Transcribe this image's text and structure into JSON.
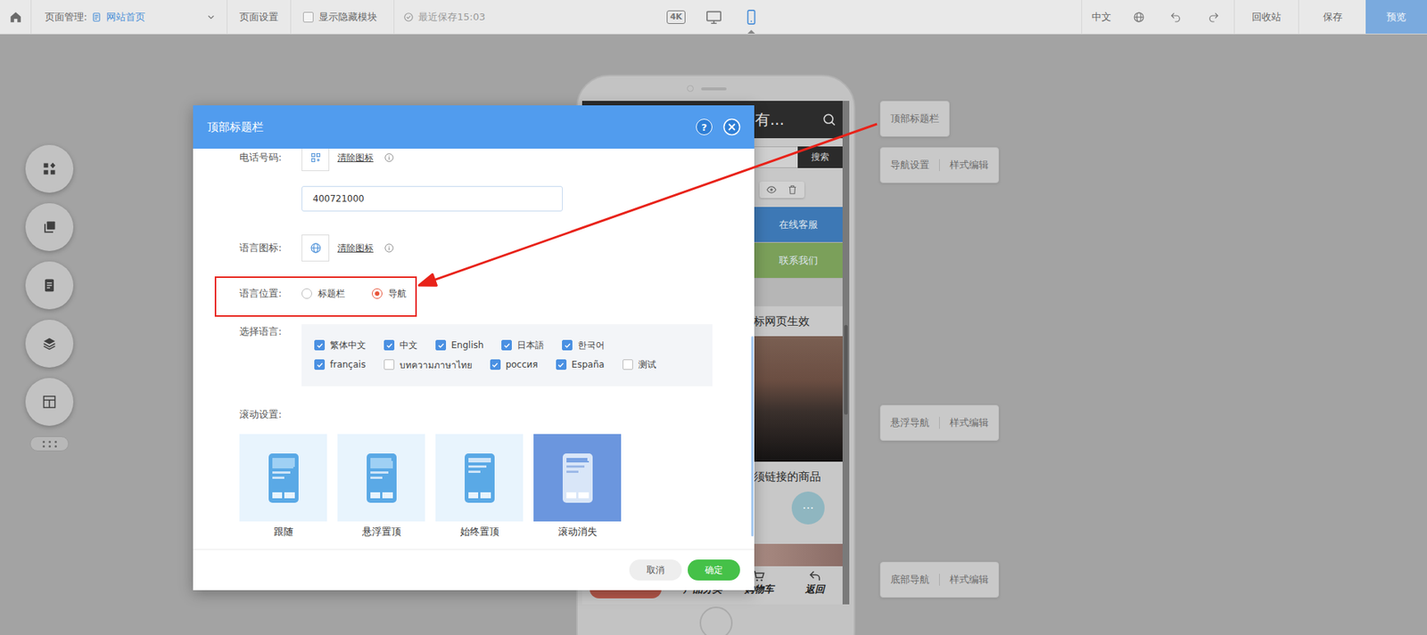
{
  "topbar": {
    "page_label": "页面管理:",
    "page_name": "网站首页",
    "page_settings": "页面设置",
    "show_hidden": {
      "label": "显示隐藏模块",
      "checked": false
    },
    "saved": "最近保存15:03",
    "devices": [
      {
        "kind": "text",
        "label": "4K",
        "selected": false
      },
      {
        "kind": "desktop",
        "selected": false
      },
      {
        "kind": "mobile",
        "selected": true
      }
    ],
    "language": "中文",
    "recycle_bin": "回收站",
    "save": "保存",
    "preview": "预览"
  },
  "phone": {
    "header_title": "有...",
    "search_button": "搜索",
    "buttons": [
      {
        "label": "在线客服",
        "color": "#3d78b5"
      },
      {
        "label": "联系我们",
        "color": "#7ba05a"
      }
    ],
    "notice": "标网页生效",
    "caption": "须链接的商品",
    "floating_button": "···",
    "bottom_nav": [
      {
        "label": "产品分类",
        "kind": "category"
      },
      {
        "label": "购物车",
        "kind": "cart"
      },
      {
        "label": "返回",
        "kind": "back"
      }
    ]
  },
  "module_labels": [
    {
      "buttons": [
        "顶部标题栏"
      ]
    },
    {
      "buttons": [
        "导航设置",
        "样式编辑"
      ]
    },
    {
      "buttons": [
        "悬浮导航",
        "样式编辑"
      ]
    },
    {
      "buttons": [
        "底部导航",
        "样式编辑"
      ]
    }
  ],
  "dialog": {
    "title": "顶部标题栏",
    "help": "?",
    "phone_number": {
      "label": "电话号码:",
      "clear": "清除图标",
      "value": "400721000"
    },
    "language_icon": {
      "label": "语言图标:",
      "clear": "清除图标"
    },
    "language_position": {
      "label": "语言位置:",
      "options": [
        {
          "label": "标题栏",
          "selected": false
        },
        {
          "label": "导航",
          "selected": true
        }
      ]
    },
    "languages": {
      "label": "选择语言:",
      "rows": [
        [
          {
            "label": "繁体中文",
            "checked": true
          },
          {
            "label": "中文",
            "checked": true
          },
          {
            "label": "English",
            "checked": true
          },
          {
            "label": "日本語",
            "checked": true
          },
          {
            "label": "한국어",
            "checked": true
          }
        ],
        [
          {
            "label": "français",
            "checked": true
          },
          {
            "label": "บทความภาษาไทย",
            "checked": false
          },
          {
            "label": "россия",
            "checked": true
          },
          {
            "label": "España",
            "checked": true
          },
          {
            "label": "测试",
            "checked": false
          }
        ]
      ]
    },
    "scroll": {
      "label": "滚动设置:",
      "options": [
        {
          "label": "跟随",
          "kind": "follow",
          "selected": false
        },
        {
          "label": "悬浮置顶",
          "kind": "float",
          "selected": false
        },
        {
          "label": "始终置顶",
          "kind": "fixed",
          "selected": false
        },
        {
          "label": "滚动消失",
          "kind": "vanish",
          "selected": true
        }
      ]
    },
    "cancel": "取消",
    "confirm": "确定"
  }
}
